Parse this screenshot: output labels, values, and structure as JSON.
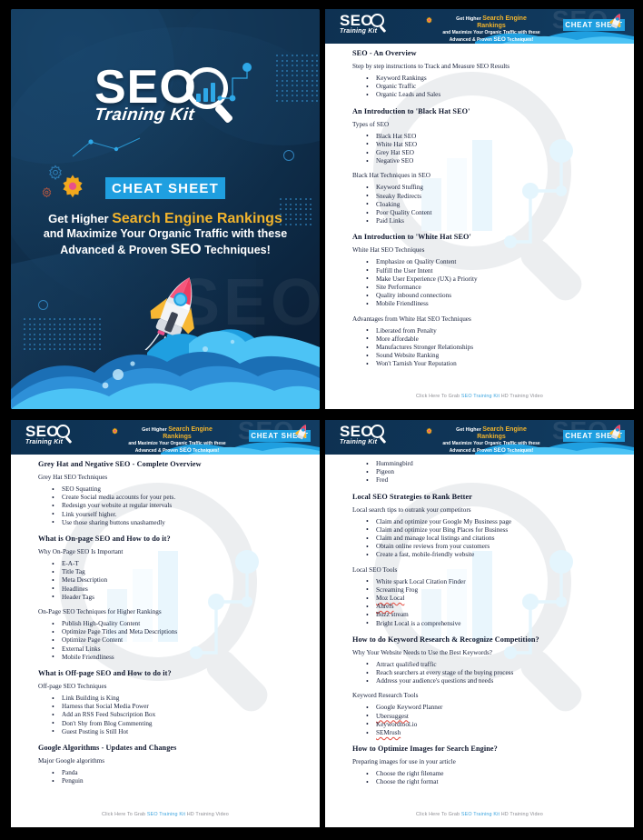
{
  "document": {
    "title": "SEO Training Kit",
    "subtitle": "Training Kit",
    "badge": "CHEAT SHEET"
  },
  "colors": {
    "cover_bg": "#0e2f52",
    "accent_blue": "#1f9fe0",
    "accent_gold": "#f2b42c",
    "wave_light": "#4cc3f5",
    "wave_mid": "#1f9fe0",
    "wave_dark": "#1b6fb5",
    "text": "#17203a",
    "link": "#3fa5df",
    "page_bg": "#ffffff",
    "canvas_bg": "#000000"
  },
  "cover": {
    "logo_main": "SEO",
    "logo_sub": "Training Kit",
    "badge": "CHEAT SHEET",
    "tagline_line1_plain": "Get Higher ",
    "tagline_line1_highlight": "Search Engine Rankings",
    "tagline_line2": "and Maximize Your Organic Traffic with these",
    "tagline_line3_plain_a": "Advanced & Proven ",
    "tagline_line3_highlight": "SEO",
    "tagline_line3_plain_b": " Techniques!",
    "ghost_text": "SEO",
    "icons": [
      "gear-icon",
      "rocket-icon",
      "magnifier-icon",
      "bar-chart-icon",
      "network-node-icon",
      "dot-grid-icon",
      "ring-icon"
    ]
  },
  "header": {
    "logo_main": "SEO",
    "logo_sub": "Training Kit",
    "tag_line1_plain": "Get Higher ",
    "tag_line1_highlight": "Search Engine Rankings",
    "tag_line2": "and Maximize Your Organic Traffic with these",
    "tag_line3_plain_a": "Advanced & Proven ",
    "tag_line3_highlight": "SEO",
    "tag_line3_plain_b": " Techniques!",
    "badge": "CHEAT SHEET",
    "ghost_text": "SEO"
  },
  "footer": {
    "prefix": "Click Here To Grab ",
    "link": "SEO Training Kit",
    "suffix": " HD Training Video"
  },
  "pages": [
    {
      "id": "page-2",
      "blocks": [
        {
          "type": "heading",
          "text": "SEO - An Overview"
        },
        {
          "type": "para",
          "text": "Step by step instructions to Track and Measure SEO Results"
        },
        {
          "type": "list",
          "items": [
            "Keyword Rankings",
            "Organic Traffic",
            "Organic Leads and Sales"
          ]
        },
        {
          "type": "heading",
          "text": "An Introduction to 'Black Hat SEO'"
        },
        {
          "type": "para",
          "text": "Types of SEO"
        },
        {
          "type": "list",
          "items": [
            "Black Hat SEO",
            "White Hat SEO",
            "Grey Hat SEO",
            "Negative SEO"
          ]
        },
        {
          "type": "para",
          "text": "Black Hat Techniques in SEO"
        },
        {
          "type": "list",
          "items": [
            "Keyword Stuffing",
            "Sneaky Redirects",
            "Cloaking",
            "Poor Quality Content",
            "Paid Links"
          ]
        },
        {
          "type": "heading",
          "text": "An Introduction to 'White Hat SEO'"
        },
        {
          "type": "para",
          "text": "White Hat SEO Techniques"
        },
        {
          "type": "list",
          "items": [
            "Emphasize on Quality Content",
            "Fulfill the User Intent",
            "Make User Experience (UX) a Priority",
            "Site Performance",
            "Quality inbound connections",
            "Mobile Friendliness"
          ]
        },
        {
          "type": "para",
          "text": "Advantages from White Hat SEO Techniques"
        },
        {
          "type": "list",
          "items": [
            "Liberated from Penalty",
            "More affordable",
            "Manufactures Stronger Relationships",
            "Sound Website Ranking",
            "Won't Tarnish Your Reputation"
          ]
        }
      ]
    },
    {
      "id": "page-3",
      "blocks": [
        {
          "type": "heading",
          "text": "Grey Hat and Negative SEO - Complete Overview"
        },
        {
          "type": "para",
          "text": "Grey Hat SEO Techniques"
        },
        {
          "type": "list",
          "items": [
            "SEO Squatting",
            "Create Social media accounts for your pets.",
            "Redesign your website at regular intervals",
            "Link yourself higher.",
            "Use those sharing buttons unashamedly"
          ]
        },
        {
          "type": "heading",
          "text": "What is On-page SEO and How to do it?"
        },
        {
          "type": "para",
          "text": "Why On-Page SEO Is Important"
        },
        {
          "type": "list",
          "items": [
            "E-A-T",
            "Title Tag",
            "Meta Description",
            "Headlines",
            "Header Tags"
          ]
        },
        {
          "type": "para",
          "text": "On-Page SEO Techniques for Higher Rankings"
        },
        {
          "type": "list",
          "items": [
            "Publish High-Quality Content",
            "Optimize Page Titles and Meta Descriptions",
            "Optimize Page Content",
            "External Links",
            "Mobile Friendliness"
          ]
        },
        {
          "type": "heading",
          "text": "What is Off-page SEO and How to do it?"
        },
        {
          "type": "para",
          "text": "Off-page SEO Techniques"
        },
        {
          "type": "list",
          "items": [
            "Link Building is King",
            "Harness that Social Media Power",
            "Add an RSS Feed Subscription Box",
            "Don't Shy from Blog Commenting",
            "Guest Posting is Still Hot"
          ]
        },
        {
          "type": "heading",
          "text": "Google Algorithms - Updates and Changes"
        },
        {
          "type": "para",
          "text": "Major Google algorithms"
        },
        {
          "type": "list",
          "items": [
            "Panda",
            "Penguin"
          ]
        }
      ]
    },
    {
      "id": "page-4",
      "blocks": [
        {
          "type": "list",
          "items": [
            "Hummingbird",
            "Pigeon",
            "Fred"
          ]
        },
        {
          "type": "heading",
          "text": "Local SEO Strategies to Rank Better"
        },
        {
          "type": "para",
          "text": "Local search tips to outrank your competitors"
        },
        {
          "type": "list",
          "items": [
            "Claim and optimize your Google My Business page",
            "Claim and optimize your Bing Places for Business",
            "Claim and manage local listings and citations",
            "Obtain online reviews from your customers",
            "Create a fast, mobile-friendly website"
          ]
        },
        {
          "type": "para",
          "text": "Local SEO Tools"
        },
        {
          "type": "list",
          "items": [
            "White spark Local Citation Finder",
            "Screaming Frog",
            "Moz Local",
            "Ahrefs",
            "Buzz stream",
            "Bright Local is a comprehensive"
          ],
          "misspelled": [
            2,
            3
          ]
        },
        {
          "type": "heading",
          "text": "How to do Keyword Research & Recognize Competition?"
        },
        {
          "type": "para",
          "text": "Why Your Website Needs to Use the Best Keywords?"
        },
        {
          "type": "list",
          "items": [
            "Attract qualified traffic",
            "Reach searchers at every stage of the buying process",
            "Address your audience's questions and needs"
          ]
        },
        {
          "type": "para",
          "text": "Keyword Research Tools"
        },
        {
          "type": "list",
          "items": [
            "Google Keyword Planner",
            "Ubersuggest",
            "Keywordtool.io",
            "SEMrush"
          ],
          "misspelled": [
            1,
            3
          ]
        },
        {
          "type": "heading",
          "text": "How to Optimize Images for Search Engine?"
        },
        {
          "type": "para",
          "text": "Preparing images for use in your article"
        },
        {
          "type": "list",
          "items": [
            "Choose the right filename",
            "Choose the right format"
          ]
        }
      ]
    }
  ]
}
